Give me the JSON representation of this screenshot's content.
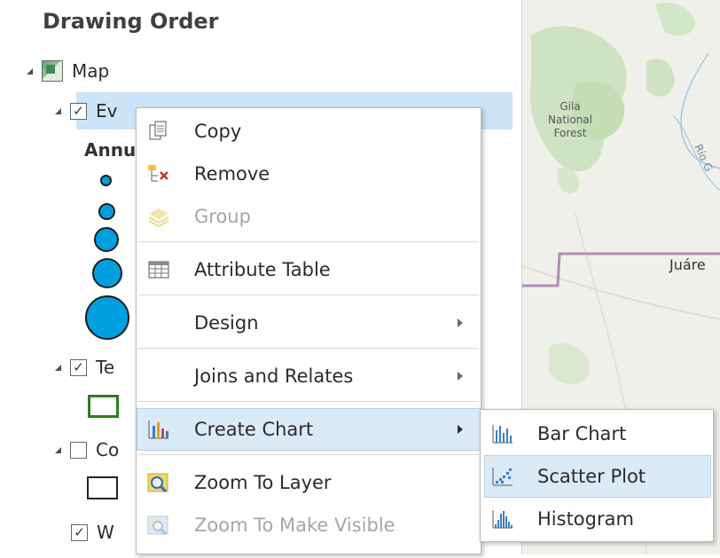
{
  "contents": {
    "title": "Drawing Order",
    "map_label": "Map",
    "layer1_label": "Ev",
    "layer1_sub": "Annu",
    "layer2_label": "Te",
    "layer3_label": "Co",
    "layer4_label": "W"
  },
  "context_menu": {
    "items": [
      {
        "label": "Copy",
        "icon": "copy-icon"
      },
      {
        "label": "Remove",
        "icon": "remove-icon"
      },
      {
        "label": "Group",
        "icon": "group-layers-icon",
        "disabled": true
      },
      {
        "label": "Attribute Table",
        "icon": "table-icon"
      },
      {
        "label": "Design",
        "submenu": true
      },
      {
        "label": "Joins and Relates",
        "submenu": true
      },
      {
        "label": "Create Chart",
        "icon": "chart-icon",
        "submenu": true,
        "highlighted": true
      },
      {
        "label": "Zoom To Layer",
        "icon": "zoom-to-layer-icon"
      },
      {
        "label": "Zoom To Make Visible",
        "icon": "zoom-visible-icon",
        "disabled": true
      }
    ]
  },
  "submenu": {
    "items": [
      {
        "label": "Bar Chart",
        "icon": "bar-chart-icon"
      },
      {
        "label": "Scatter Plot",
        "icon": "scatter-plot-icon",
        "highlighted": true
      },
      {
        "label": "Histogram",
        "icon": "histogram-icon"
      }
    ]
  },
  "map": {
    "labels": [
      "Gila",
      "National",
      "Forest",
      "Juáre",
      "Río G"
    ]
  },
  "colors": {
    "accent": "#00a0e0",
    "selection": "#cce4f7",
    "highlight": "#dbeaf7",
    "green_outline": "#2e7d1f"
  }
}
